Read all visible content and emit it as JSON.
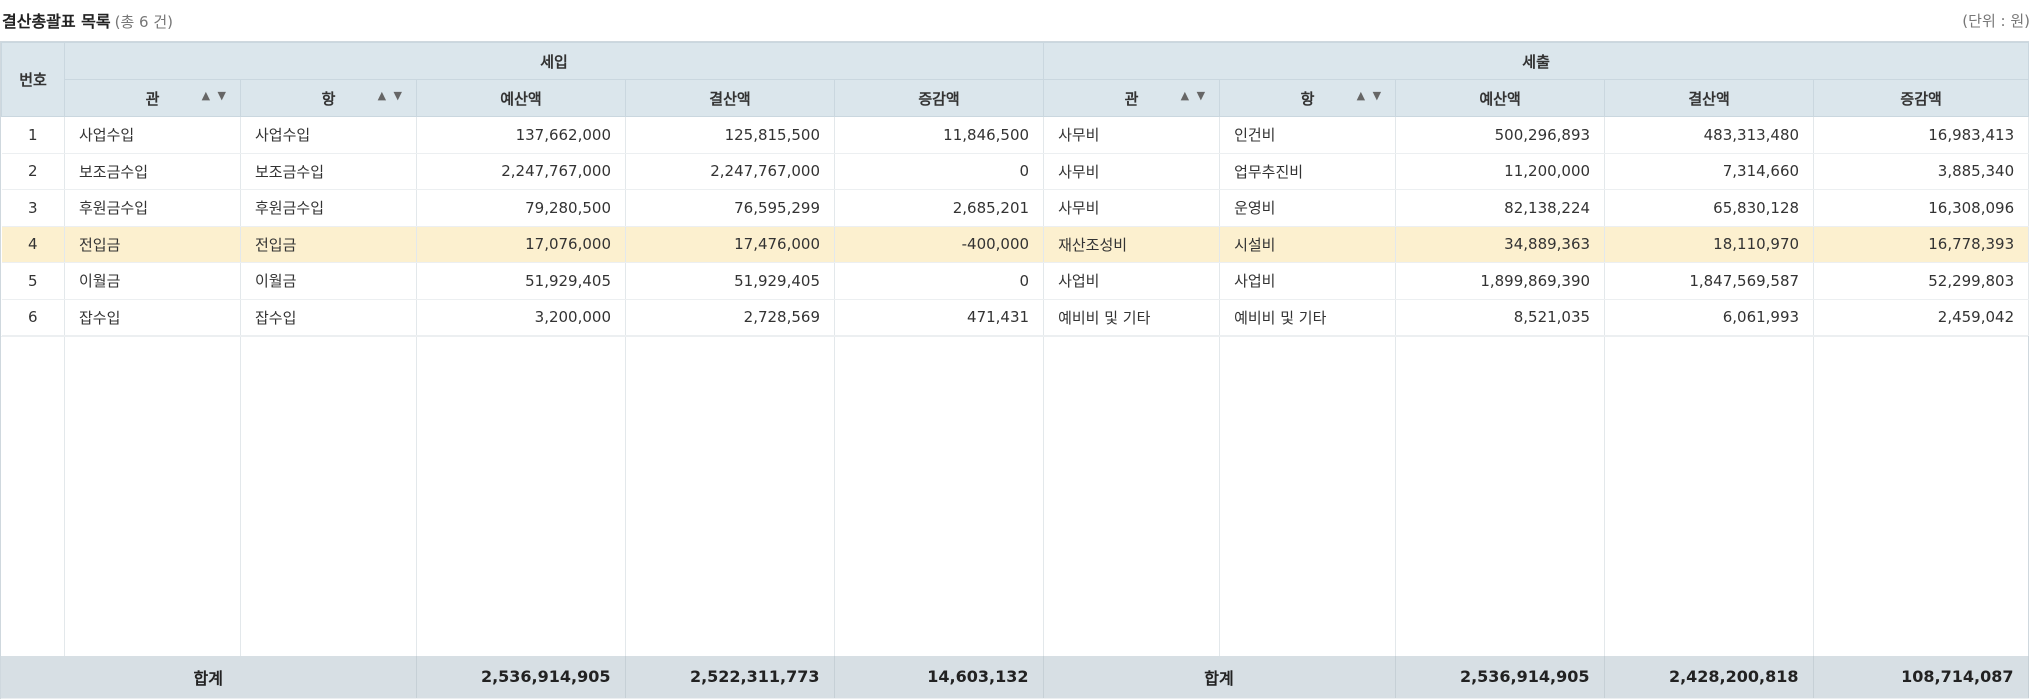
{
  "header": {
    "title": "결산총괄표 목록",
    "count": "(총 6 건)",
    "unit": "(단위 : 원)"
  },
  "columns": {
    "no": "번호",
    "income_group": "세입",
    "expense_group": "세출",
    "gwan": "관",
    "hang": "항",
    "budget": "예산액",
    "settled": "결산액",
    "diff": "증감액",
    "sort_icon": "▲ ▼"
  },
  "rows": [
    {
      "no": "1",
      "in_gwan": "사업수입",
      "in_hang": "사업수입",
      "in_budget": "137,662,000",
      "in_settled": "125,815,500",
      "in_diff": "11,846,500",
      "ex_gwan": "사무비",
      "ex_hang": "인건비",
      "ex_budget": "500,296,893",
      "ex_settled": "483,313,480",
      "ex_diff": "16,983,413"
    },
    {
      "no": "2",
      "in_gwan": "보조금수입",
      "in_hang": "보조금수입",
      "in_budget": "2,247,767,000",
      "in_settled": "2,247,767,000",
      "in_diff": "0",
      "ex_gwan": "사무비",
      "ex_hang": "업무추진비",
      "ex_budget": "11,200,000",
      "ex_settled": "7,314,660",
      "ex_diff": "3,885,340"
    },
    {
      "no": "3",
      "in_gwan": "후원금수입",
      "in_hang": "후원금수입",
      "in_budget": "79,280,500",
      "in_settled": "76,595,299",
      "in_diff": "2,685,201",
      "ex_gwan": "사무비",
      "ex_hang": "운영비",
      "ex_budget": "82,138,224",
      "ex_settled": "65,830,128",
      "ex_diff": "16,308,096"
    },
    {
      "no": "4",
      "in_gwan": "전입금",
      "in_hang": "전입금",
      "in_budget": "17,076,000",
      "in_settled": "17,476,000",
      "in_diff": "-400,000",
      "ex_gwan": "재산조성비",
      "ex_hang": "시설비",
      "ex_budget": "34,889,363",
      "ex_settled": "18,110,970",
      "ex_diff": "16,778,393"
    },
    {
      "no": "5",
      "in_gwan": "이월금",
      "in_hang": "이월금",
      "in_budget": "51,929,405",
      "in_settled": "51,929,405",
      "in_diff": "0",
      "ex_gwan": "사업비",
      "ex_hang": "사업비",
      "ex_budget": "1,899,869,390",
      "ex_settled": "1,847,569,587",
      "ex_diff": "52,299,803"
    },
    {
      "no": "6",
      "in_gwan": "잡수입",
      "in_hang": "잡수입",
      "in_budget": "3,200,000",
      "in_settled": "2,728,569",
      "in_diff": "471,431",
      "ex_gwan": "예비비 및 기타",
      "ex_hang": "예비비 및 기타",
      "ex_budget": "8,521,035",
      "ex_settled": "6,061,993",
      "ex_diff": "2,459,042"
    }
  ],
  "selected_row": "4",
  "totals": {
    "label": "합계",
    "in_budget": "2,536,914,905",
    "in_settled": "2,522,311,773",
    "in_diff": "14,603,132",
    "ex_budget": "2,536,914,905",
    "ex_settled": "2,428,200,818",
    "ex_diff": "108,714,087"
  },
  "colors": {
    "header_bg": "#dbe6ec",
    "selected_bg": "#fcf0cf",
    "footer_bg": "#d7dfe4"
  }
}
